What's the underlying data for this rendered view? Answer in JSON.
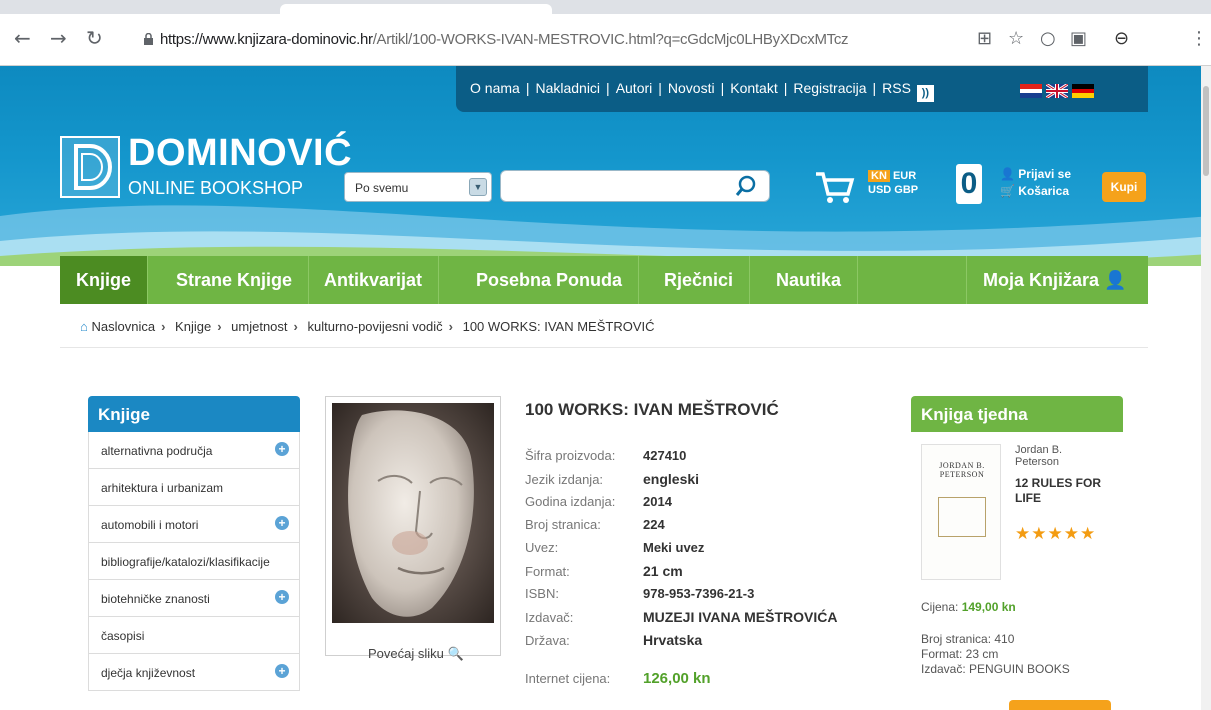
{
  "browser": {
    "url_host": "https://www.knjizara-dominovic.hr",
    "url_path": "/Artikl/100-WORKS-IVAN-MESTROVIC.html?q=cGdcMjc0LHByXDcxMTcz"
  },
  "header": {
    "top_links": [
      "O nama",
      "Nakladnici",
      "Autori",
      "Novosti",
      "Kontakt",
      "Registracija",
      "RSS"
    ],
    "logo_name": "DOMINOVIĆ",
    "logo_sub": "ONLINE BOOKSHOP",
    "search_scope": "Po svemu",
    "currency_kn": "KN",
    "currency_eur": "EUR",
    "currency_usd": "USD",
    "currency_gbp": "GBP",
    "cart_count": "0",
    "login_label": "Prijavi se",
    "cart_label": "Košarica",
    "buy_label": "Kupi"
  },
  "nav": {
    "items": [
      "Knjige",
      "Strane Knjige",
      "Antikvarijat",
      "Posebna Ponuda",
      "Rječnici",
      "Nautika"
    ],
    "account": "Moja Knjižara"
  },
  "breadcrumb": [
    "Naslovnica",
    "Knjige",
    "umjetnost",
    "kulturno-povijesni vodič",
    "100 WORKS: IVAN MEŠTROVIĆ"
  ],
  "sidebar": {
    "title": "Knjige",
    "categories": [
      "alternativna područja",
      "arhitektura i urbanizam",
      "automobili i motori",
      "bibliografije/katalozi/klasifikacije",
      "biotehničke znanosti",
      "časopisi",
      "dječja književnost"
    ]
  },
  "product": {
    "title": "100 WORKS: IVAN MEŠTROVIĆ",
    "enlarge_label": "Povećaj sliku",
    "specs": [
      {
        "label": "Šifra proizvoda:",
        "value": "427410"
      },
      {
        "label": "Jezik izdanja:",
        "value": "engleski"
      },
      {
        "label": "Godina izdanja:",
        "value": "2014"
      },
      {
        "label": "Broj stranica:",
        "value": "224"
      },
      {
        "label": "Uvez:",
        "value": "Meki uvez"
      },
      {
        "label": "Format:",
        "value": "21 cm"
      },
      {
        "label": "ISBN:",
        "value": "978-953-7396-21-3"
      },
      {
        "label": "Izdavač:",
        "value": "MUZEJI IVANA MEŠTROVIĆA"
      },
      {
        "label": "Država:",
        "value": "Hrvatska"
      }
    ],
    "price_label": "Internet cijena:",
    "price_value": "126,00 kn"
  },
  "book_of_week": {
    "title": "Knjiga tjedna",
    "author_line1": "Jordan B.",
    "author_line2": "Peterson",
    "book_title_line1": "12 RULES FOR",
    "book_title_line2": "LIFE",
    "stars": "★★★★★",
    "cover_author": "JORDAN B. PETERSON",
    "price_label": "Cijena:",
    "price_value": "149,00 kn",
    "pages": "Broj stranica: 410",
    "format": "Format: 23 cm",
    "publisher": "Izdavač: PENGUIN BOOKS"
  }
}
